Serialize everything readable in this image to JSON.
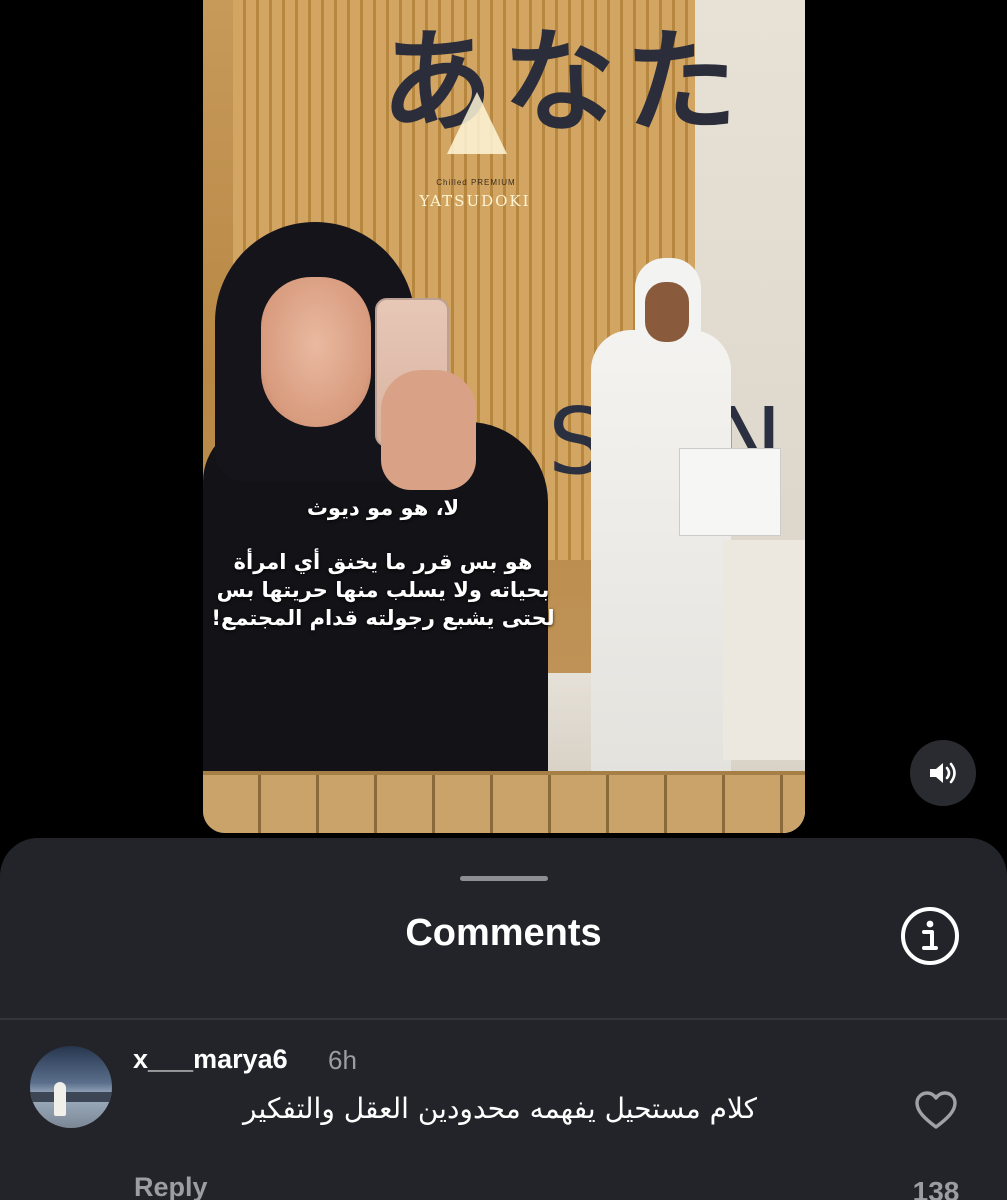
{
  "video": {
    "sign_japanese": "あなた",
    "brand_sign": "YATSUDOKI",
    "brand_sub": "Chilled PREMIUM",
    "store_sign": "SIN",
    "overlay": {
      "line1": "لا، هو مو ديوث",
      "line2": "هو بس قرر ما يخنق أي امرأة بحياته ولا يسلب منها حريتها بس لحتى يشبع رجولته قدام المجتمع!"
    },
    "sound_icon": "speaker-volume-icon"
  },
  "comments_sheet": {
    "title": "Comments",
    "info_icon": "info-icon",
    "comments": [
      {
        "username": "x___marya6",
        "time": "6h",
        "text": "كلام مستحيل يفهمه محدودين العقل والتفكير",
        "reply_label": "Reply",
        "likes": "138",
        "like_icon": "heart-icon"
      }
    ]
  },
  "colors": {
    "background": "#000000",
    "sheet": "#232429",
    "secondary_text": "#9c9da2",
    "primary_text": "#ffffff"
  }
}
